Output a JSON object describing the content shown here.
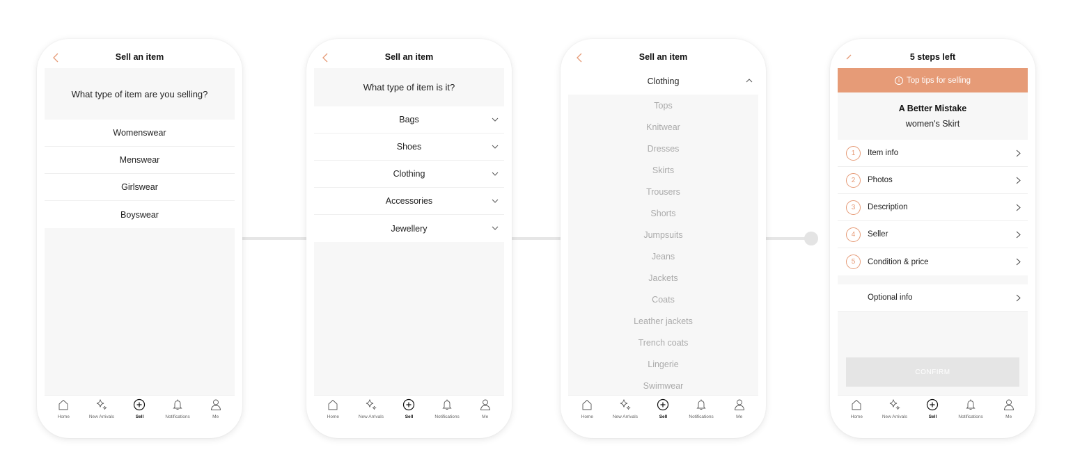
{
  "screens": [
    {
      "title": "Sell an item",
      "question": "What type of item are you selling?",
      "options": [
        "Womenswear",
        "Menswear",
        "Girlswear",
        "Boyswear"
      ]
    },
    {
      "title": "Sell an item",
      "question": "What type of item is it?",
      "categories": [
        "Bags",
        "Shoes",
        "Clothing",
        "Accessories",
        "Jewellery"
      ]
    },
    {
      "title": "Sell an item",
      "expanded_category": "Clothing",
      "subcategories": [
        "Tops",
        "Knitwear",
        "Dresses",
        "Skirts",
        "Trousers",
        "Shorts",
        "Jumpsuits",
        "Jeans",
        "Jackets",
        "Coats",
        "Leather jackets",
        "Trench coats",
        "Lingerie",
        "Swimwear"
      ]
    },
    {
      "title": "5 steps left",
      "tips_banner": "Top tips for selling",
      "tips_icon": "i",
      "brand": "A Better Mistake",
      "item_kind": "women's Skirt",
      "steps": [
        {
          "num": "1",
          "label": "Item info"
        },
        {
          "num": "2",
          "label": "Photos"
        },
        {
          "num": "3",
          "label": "Description"
        },
        {
          "num": "4",
          "label": "Seller"
        },
        {
          "num": "5",
          "label": "Condition & price"
        }
      ],
      "optional": "Optional info",
      "confirm_label": "CONFIRM"
    }
  ],
  "bottom_nav": [
    {
      "label": "Home",
      "icon": "home-icon"
    },
    {
      "label": "New Arrivals",
      "icon": "sparkle-icon"
    },
    {
      "label": "Sell",
      "icon": "plus-circle-icon",
      "active": true
    },
    {
      "label": "Notifications",
      "icon": "bell-icon"
    },
    {
      "label": "Me",
      "icon": "user-icon"
    }
  ],
  "colors": {
    "accent": "#e69b77",
    "panel": "#f7f7f7",
    "muted_text": "#aaaaaa",
    "disabled_button": "#e5e5e5"
  }
}
